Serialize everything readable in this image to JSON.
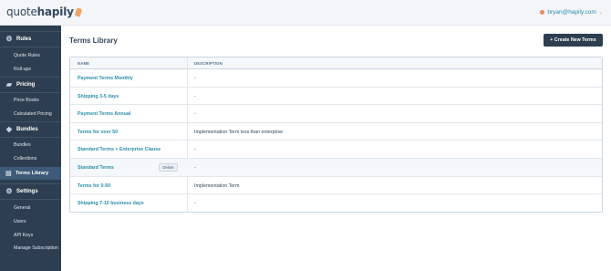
{
  "header": {
    "logo_text_light": "quote",
    "logo_text_bold": "hapily",
    "user_email": "bryan@hapily.com",
    "user_caret": "⌄"
  },
  "sidebar": {
    "sections": [
      {
        "label": "Rules",
        "icon": "gear-icon"
      },
      {
        "label": "Pricing",
        "icon": "price-tag-icon"
      },
      {
        "label": "Bundles",
        "icon": "bundles-icon"
      },
      {
        "label": "Settings",
        "icon": "gear-icon"
      }
    ],
    "items": {
      "quote_rules": "Quote Rules",
      "roll_ups": "Roll-ups",
      "price_books": "Price Books",
      "calculated_pricing": "Calculated Pricing",
      "bundles": "Bundles",
      "collections": "Collections",
      "terms_library": "Terms Library",
      "general": "General",
      "users": "Users",
      "api_keys": "API Keys",
      "manage_subscription": "Manage Subscription"
    }
  },
  "main": {
    "title": "Terms Library",
    "create_button": "+ Create New Terms",
    "columns": [
      "NAME",
      "DESCRIPTION"
    ],
    "delete_label": "Delete",
    "rows": [
      {
        "name": "Payment Terms Monthly",
        "description": "-"
      },
      {
        "name": "Shipping 3-5 days",
        "description": "-"
      },
      {
        "name": "Payment Terms Annual",
        "description": "-"
      },
      {
        "name": "Terms for over 50",
        "description": "Implementation Term less than enterprise"
      },
      {
        "name": "Standard Terms + Enterprise Clause",
        "description": "-"
      },
      {
        "name": "Standard Terms",
        "description": "-"
      },
      {
        "name": "Terms for 0-50",
        "description": "Implementation Term"
      },
      {
        "name": "Shipping 7-10 business days",
        "description": "-"
      }
    ]
  },
  "colors": {
    "sidebar_bg": "#2d3e50",
    "active_item_bg": "#3e5a78",
    "link": "#2a8fa8",
    "primary_button": "#2d3e50"
  }
}
